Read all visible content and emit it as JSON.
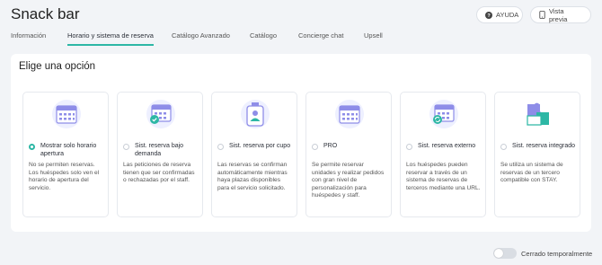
{
  "header": {
    "title": "Snack bar",
    "help_label": "AYUDA",
    "preview_label": "Vista previa",
    "help_icon": "question-circle-icon",
    "preview_icon": "phone-icon"
  },
  "tabs": [
    {
      "label": "Información",
      "active": false
    },
    {
      "label": "Horario y sistema de reserva",
      "active": true
    },
    {
      "label": "Catálogo Avanzado",
      "active": false
    },
    {
      "label": "Catálogo",
      "active": false
    },
    {
      "label": "Concierge chat",
      "active": false
    },
    {
      "label": "Upsell",
      "active": false
    }
  ],
  "panel": {
    "title": "Elige una opción",
    "options": [
      {
        "icon": "calendar-icon",
        "label": "Mostrar solo horario apertura",
        "selected": true,
        "description": "No se permiten reservas. Los huéspedes solo ven el horario de apertura del servicio."
      },
      {
        "icon": "calendar-check-icon",
        "label": "Sist. reserva bajo demanda",
        "selected": false,
        "description": "Las peticiones de reserva tienen que ser confirmadas o rechazadas por el staff."
      },
      {
        "icon": "badge-id-icon",
        "label": "Sist. reserva por cupo",
        "selected": false,
        "description": "Las reservas se confirman automáticamente mientras haya plazas disponibles para el servicio solicitado."
      },
      {
        "icon": "calendar-icon",
        "label": "PRO",
        "selected": false,
        "description": "Se permite reservar unidades y realizar pedidos con gran nivel de personalización para huéspedes y staff."
      },
      {
        "icon": "calendar-sync-icon",
        "label": "Sist. reserva externo",
        "selected": false,
        "description": "Los huéspedes pueden reservar a través de un sistema de reservas de terceros mediante una URL."
      },
      {
        "icon": "puzzle-icon",
        "label": "Sist. reserva integrado",
        "selected": false,
        "description": "Se utiliza un sistema de reservas de un tercero compatible con STAY."
      }
    ]
  },
  "footer": {
    "toggle_label": "Cerrado temporalmente",
    "toggle_on": false
  },
  "colors": {
    "accent": "#2db7a5",
    "icon_purple": "#8e8de8",
    "background": "#f2f4f7"
  }
}
